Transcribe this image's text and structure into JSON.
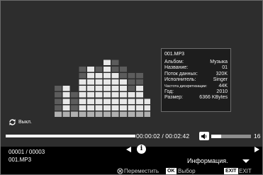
{
  "info_panel": {
    "filename": "001.MP3",
    "rows": [
      {
        "key": "Альбом:",
        "value": "Музыка"
      },
      {
        "key": "Название:",
        "value": "01"
      },
      {
        "key": "Поток данных:",
        "value": "320K"
      },
      {
        "key": "Исполнитель:",
        "value": "Singer"
      },
      {
        "key": "Частота дискретизации:",
        "value": "44K"
      },
      {
        "key": "Год:",
        "value": "2010"
      },
      {
        "key": "Размер:",
        "value": "6366 KBytes"
      }
    ]
  },
  "repeat": {
    "label": "Выкл.",
    "icon": "repeat-icon"
  },
  "playback": {
    "time": "00:00:02 / 00:02:42",
    "progress_fraction": 0.012
  },
  "volume": {
    "value": "16",
    "level_fraction": 0.25,
    "icon": "speaker-icon"
  },
  "track": {
    "counter": "00001 / 00003",
    "filename": "001.MP3"
  },
  "menu": {
    "selected": "Информация."
  },
  "help": {
    "move_label": "Переместить",
    "ok_key": "OK",
    "ok_label": "Выбор",
    "exit_key": "EXIT",
    "exit_label": "EXIT"
  },
  "equalizer": {
    "bars": [
      {
        "dark": 4,
        "light": 0
      },
      {
        "dark": 0,
        "light": 4
      },
      {
        "dark": 3,
        "light": 0
      },
      {
        "dark": 2,
        "light": 5
      },
      {
        "dark": 0,
        "light": 7
      },
      {
        "dark": 1,
        "light": 6
      },
      {
        "dark": 0,
        "light": 8
      },
      {
        "dark": 2,
        "light": 6
      },
      {
        "dark": 2,
        "light": 5
      },
      {
        "dark": 3,
        "light": 3
      },
      {
        "dark": 2,
        "light": 4
      },
      {
        "dark": 0,
        "light": 2
      }
    ],
    "base_cells": 1
  },
  "colors": {
    "background": "#2d2d2d",
    "eq_light": "#e8e8e8",
    "eq_dark": "#5c5c5c",
    "eq_base": "#b0b0b0"
  }
}
